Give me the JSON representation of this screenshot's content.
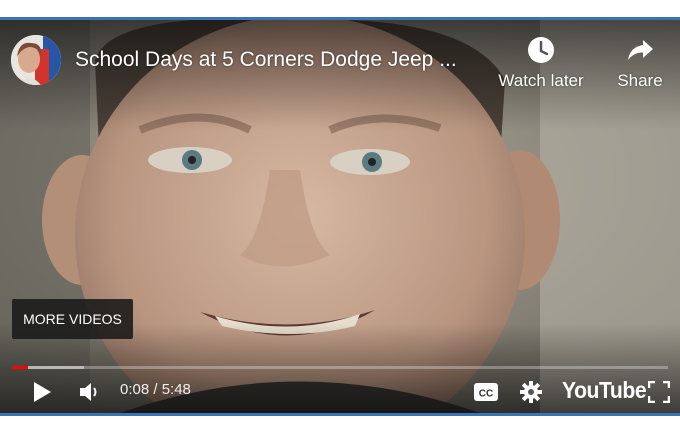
{
  "video": {
    "title": "School Days at 5 Corners Dodge Jeep ...",
    "channel_avatar_icon": "channel-avatar"
  },
  "top_actions": {
    "watch_later_label": "Watch later",
    "watch_later_icon": "clock-icon",
    "share_label": "Share",
    "share_icon": "share-arrow-icon"
  },
  "overlay": {
    "more_videos_label": "MORE VIDEOS"
  },
  "controls": {
    "time_display": "0:08 / 5:48",
    "progress": {
      "played_fraction": 0.024,
      "loaded_fraction": 0.11
    },
    "play_icon": "play-icon",
    "volume_icon": "volume-icon",
    "captions_icon": "cc-icon",
    "settings_icon": "gear-icon",
    "brand_label": "YouTube",
    "fullscreen_icon": "fullscreen-icon"
  },
  "colors": {
    "frame_accent": "#3a74b8",
    "progress_red": "#ff0000"
  }
}
